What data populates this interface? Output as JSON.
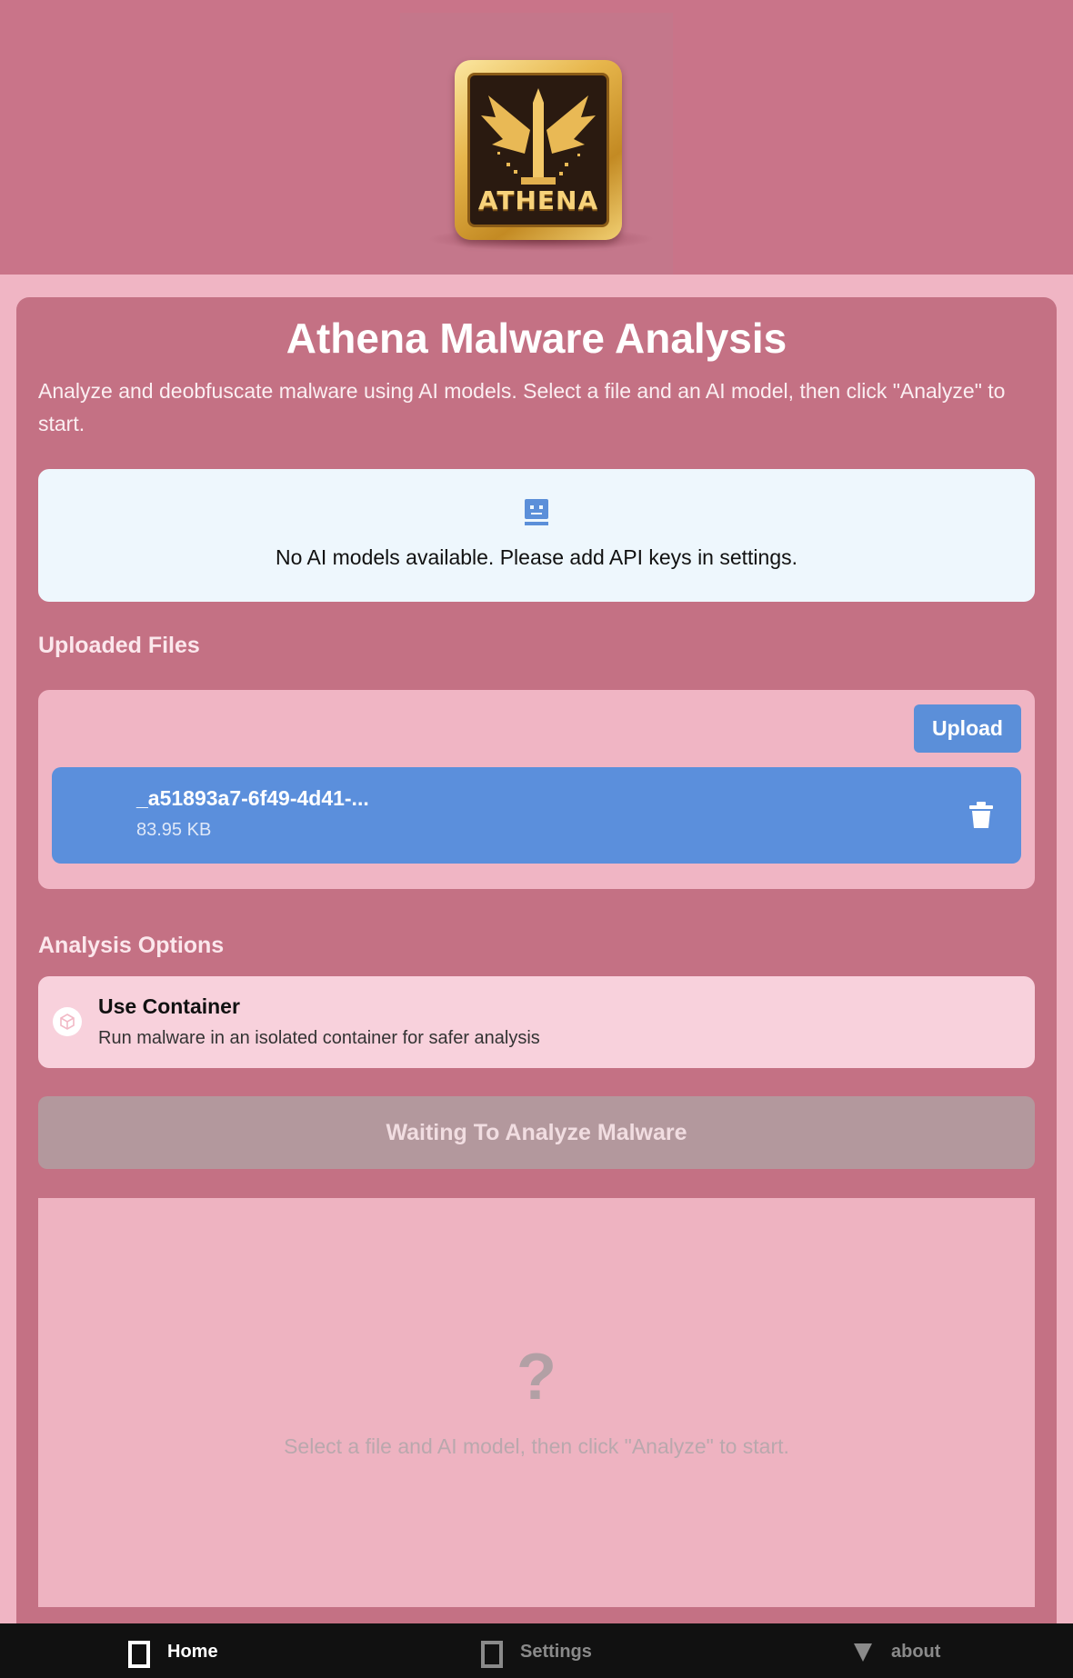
{
  "header": {
    "logo_text": "ATHENA"
  },
  "main": {
    "title": "Athena Malware Analysis",
    "description": "Analyze and deobfuscate malware using AI models. Select a file and an AI model, then click \"Analyze\" to start.",
    "models_message": "No AI models available. Please add API keys in settings."
  },
  "files": {
    "section_title": "Uploaded Files",
    "upload_label": "Upload",
    "items": [
      {
        "name": "_a51893a7-6f49-4d41-...",
        "size": "83.95 KB"
      }
    ]
  },
  "options": {
    "section_title": "Analysis Options",
    "container_title": "Use Container",
    "container_desc": "Run malware in an isolated container for safer analysis"
  },
  "analyze": {
    "button_label": "Waiting To Analyze Malware"
  },
  "results": {
    "placeholder_icon": "?",
    "placeholder_message": "Select a file and AI model, then click \"Analyze\" to start."
  },
  "nav": {
    "items": [
      {
        "label": "Home",
        "icon": "home-icon",
        "active": true
      },
      {
        "label": "Settings",
        "icon": "settings-icon",
        "active": false
      },
      {
        "label": "about",
        "icon": "about-icon",
        "active": false
      }
    ]
  },
  "colors": {
    "header_bg": "#c97489",
    "page_bg": "#f0b5c4",
    "card_bg": "#c47184",
    "accent_blue": "#5b8fd9",
    "nav_bg": "#111111"
  }
}
